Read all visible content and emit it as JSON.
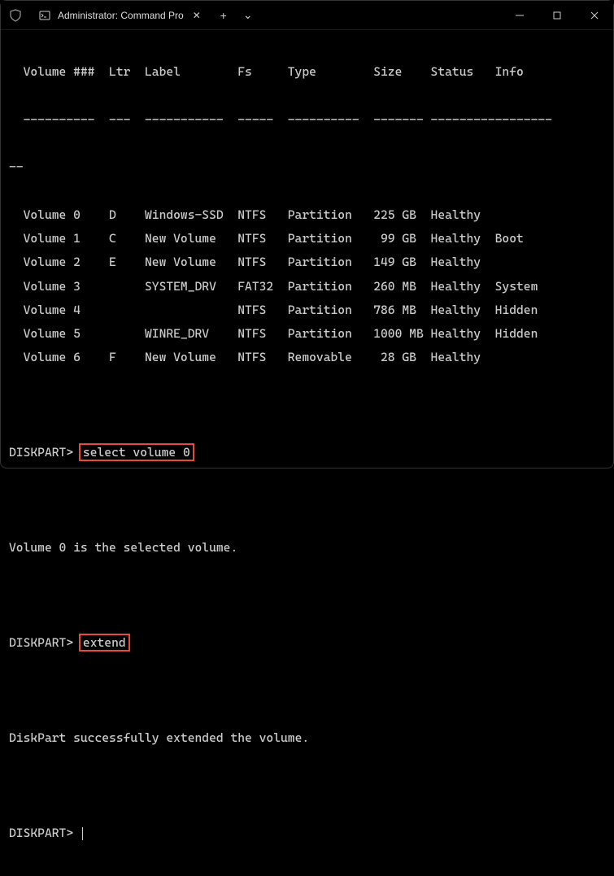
{
  "titlebar": {
    "tab_title": "Administrator: Command Pro",
    "new_tab_glyph": "+",
    "dropdown_glyph": "⌄",
    "minimize_glyph": "—",
    "maximize_glyph": "▢",
    "close_glyph": "✕",
    "tab_close_glyph": "✕"
  },
  "table": {
    "headers": {
      "volume": "Volume ###",
      "ltr": "Ltr",
      "label": "Label",
      "fs": "Fs",
      "type": "Type",
      "size": "Size",
      "status": "Status",
      "info": "Info"
    },
    "dashes": {
      "volume": "----------",
      "ltr": "---",
      "label": "-----------",
      "fs": "-----",
      "type": "----------",
      "size": "-------",
      "status": "---------",
      "info": "--------"
    },
    "tail_dashes": "--",
    "rows": [
      {
        "volume": "Volume 0",
        "ltr": "D",
        "label": "Windows-SSD",
        "fs": "NTFS",
        "type": "Partition",
        "size": "225 GB",
        "status": "Healthy",
        "info": ""
      },
      {
        "volume": "Volume 1",
        "ltr": "C",
        "label": "New Volume",
        "fs": "NTFS",
        "type": "Partition",
        "size": "99 GB",
        "status": "Healthy",
        "info": "Boot"
      },
      {
        "volume": "Volume 2",
        "ltr": "E",
        "label": "New Volume",
        "fs": "NTFS",
        "type": "Partition",
        "size": "149 GB",
        "status": "Healthy",
        "info": ""
      },
      {
        "volume": "Volume 3",
        "ltr": "",
        "label": "SYSTEM_DRV",
        "fs": "FAT32",
        "type": "Partition",
        "size": "260 MB",
        "status": "Healthy",
        "info": "System"
      },
      {
        "volume": "Volume 4",
        "ltr": "",
        "label": "",
        "fs": "NTFS",
        "type": "Partition",
        "size": "786 MB",
        "status": "Healthy",
        "info": "Hidden"
      },
      {
        "volume": "Volume 5",
        "ltr": "",
        "label": "WINRE_DRV",
        "fs": "NTFS",
        "type": "Partition",
        "size": "1000 MB",
        "status": "Healthy",
        "info": "Hidden"
      },
      {
        "volume": "Volume 6",
        "ltr": "F",
        "label": "New Volume",
        "fs": "NTFS",
        "type": "Removable",
        "size": "28 GB",
        "status": "Healthy",
        "info": ""
      }
    ]
  },
  "lines": {
    "prompt": "DISKPART>",
    "cmd1": "select volume 0",
    "resp1": "Volume 0 is the selected volume.",
    "cmd2": "extend",
    "resp2": "DiskPart successfully extended the volume."
  }
}
